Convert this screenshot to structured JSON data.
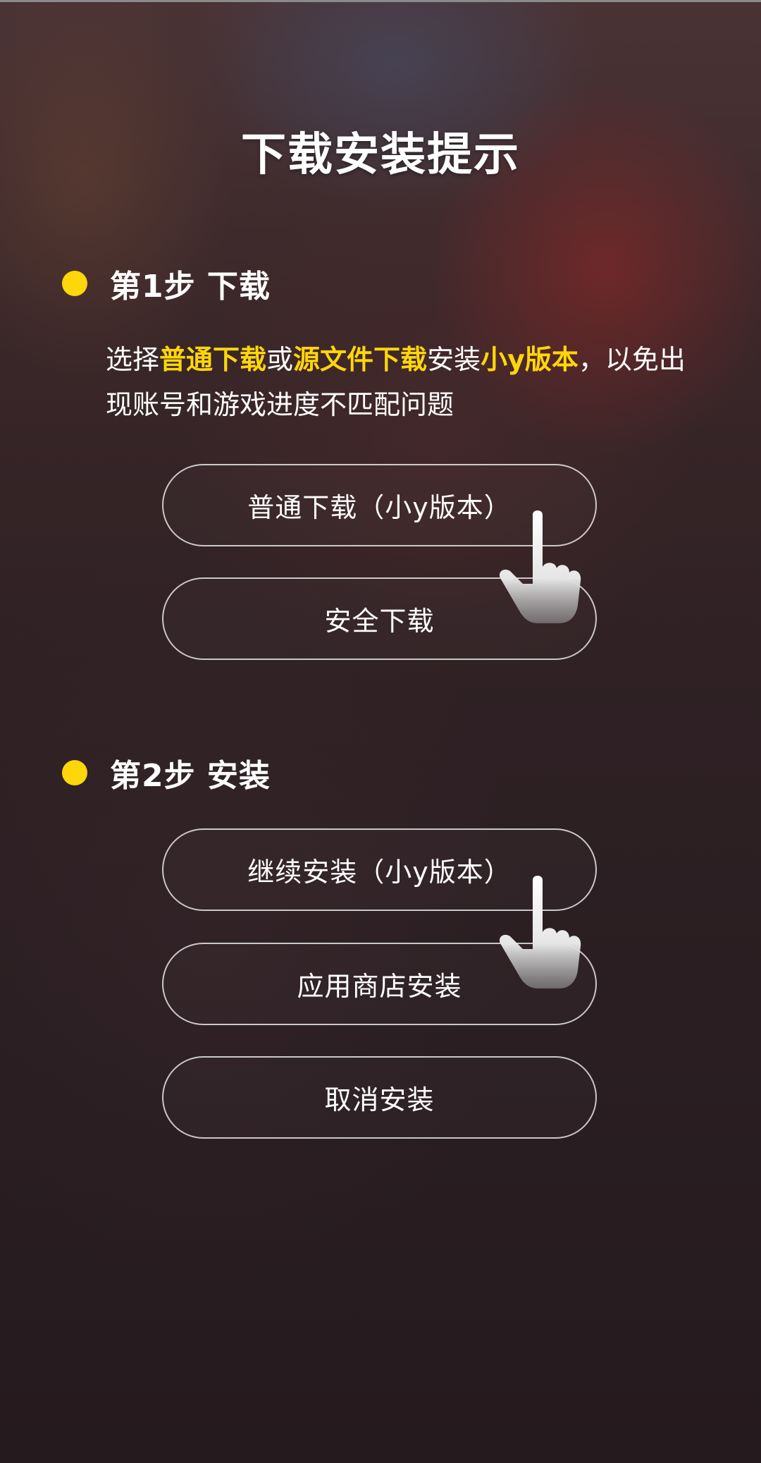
{
  "title": "下载安装提示",
  "step1": {
    "label": "第1步 下载",
    "desc": {
      "t1": "选择",
      "h1": "普通下载",
      "t2": "或",
      "h2": "源文件下载",
      "t3": "安装",
      "h3": "小y版本",
      "t4": "，以免出现账号和游戏进度不匹配问题"
    },
    "buttons": {
      "normal": "普通下载（小y版本）",
      "safe": "安全下载"
    }
  },
  "step2": {
    "label": "第2步 安装",
    "buttons": {
      "continue": "继续安装（小y版本）",
      "store": "应用商店安装",
      "cancel": "取消安装"
    }
  },
  "icons": {
    "bullet": "yellow-dot",
    "pointer": "hand-pointer-icon"
  },
  "colors": {
    "accent": "#ffd60a",
    "text": "#ffffff",
    "button_border": "#d9d9d9"
  }
}
